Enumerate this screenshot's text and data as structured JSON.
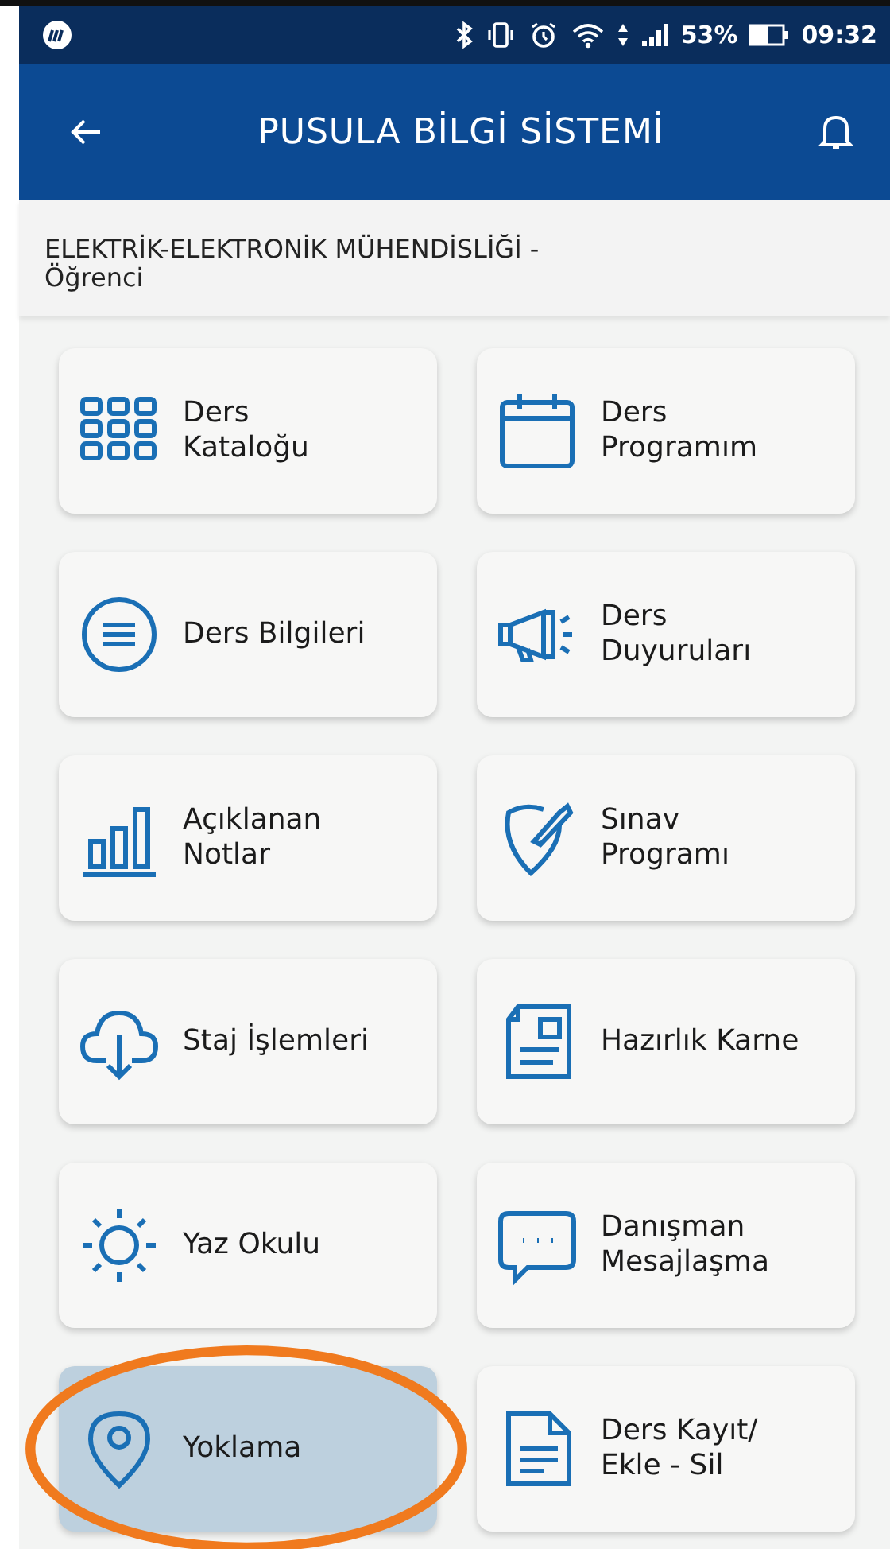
{
  "status_bar": {
    "battery": "53%",
    "time": "09:32"
  },
  "app_bar": {
    "title": "PUSULA BİLGİ SİSTEMİ"
  },
  "subtitle": "ELEKTRİK-ELEKTRONİK MÜHENDİSLİĞİ - Öğrenci",
  "tiles": [
    {
      "kind": "grid",
      "label": "Ders\nKataloğu",
      "highlighted": false
    },
    {
      "kind": "calendar",
      "label": "Ders\nProgramım",
      "highlighted": false
    },
    {
      "kind": "list",
      "label": "Ders Bilgileri",
      "highlighted": false
    },
    {
      "kind": "megaphone",
      "label": "Ders\nDuyuruları",
      "highlighted": false
    },
    {
      "kind": "bars",
      "label": "Açıklanan\nNotlar",
      "highlighted": false
    },
    {
      "kind": "shield",
      "label": "Sınav\nProgramı",
      "highlighted": false
    },
    {
      "kind": "cloud",
      "label": "Staj İşlemleri",
      "highlighted": false
    },
    {
      "kind": "document",
      "label": "Hazırlık Karne",
      "highlighted": false
    },
    {
      "kind": "sun",
      "label": "Yaz Okulu",
      "highlighted": false
    },
    {
      "kind": "chat",
      "label": "Danışman\nMesajlaşma",
      "highlighted": false
    },
    {
      "kind": "pin",
      "label": "Yoklama",
      "highlighted": true
    },
    {
      "kind": "file",
      "label": "Ders Kayıt/\nEkle - Sil",
      "highlighted": false
    }
  ]
}
